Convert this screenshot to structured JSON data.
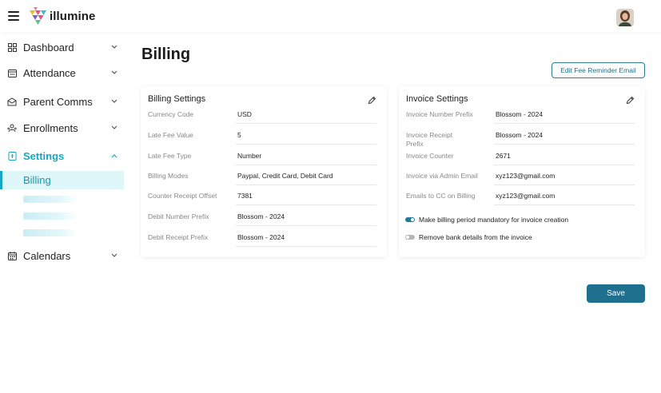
{
  "app": {
    "brand_name": "illumine",
    "brand_colors": [
      "#f2b233",
      "#e94f7c",
      "#3fb6e0",
      "#7b61c9",
      "#5cc28d"
    ],
    "accent": "#1aa6c0"
  },
  "sidebar": {
    "items": [
      {
        "label": "Dashboard",
        "icon": "dashboard-icon",
        "expanded": false
      },
      {
        "label": "Attendance",
        "icon": "attendance-icon",
        "expanded": false
      },
      {
        "label": "Parent Comms",
        "icon": "parent-comms-icon",
        "expanded": false
      },
      {
        "label": "Enrollments",
        "icon": "enrollments-icon",
        "expanded": false
      },
      {
        "label": "Settings",
        "icon": "settings-icon",
        "expanded": true,
        "active": true
      },
      {
        "label": "Calendars",
        "icon": "calendar-icon",
        "expanded": false
      }
    ],
    "settings_sub": {
      "active_label": "Billing"
    }
  },
  "main": {
    "title": "Billing",
    "edit_reminder_label": "Edit Fee Reminder Email",
    "save_label": "Save"
  },
  "billing_settings": {
    "title": "Billing Settings",
    "rows": [
      {
        "label": "Currency Code",
        "value": "USD"
      },
      {
        "label": "Late Fee Value",
        "value": "5"
      },
      {
        "label": "Late Fee Type",
        "value": "Number"
      },
      {
        "label": "Billing Modes",
        "value": "Paypal, Credit Card, Debit Card"
      },
      {
        "label": "Counter Receipt Offset",
        "value": "7381"
      },
      {
        "label": "Debit Number Prefix",
        "value": "Blossom - 2024"
      },
      {
        "label": "Debit Receipt Prefix",
        "value": "Blossom - 2024"
      }
    ]
  },
  "invoice_settings": {
    "title": "Invoice Settings",
    "rows": [
      {
        "label": "Invoice Number Prefix",
        "value": "Blossom - 2024"
      },
      {
        "label": "Invoice Receipt",
        "label2": "Prefix",
        "value": "Blossom - 2024"
      },
      {
        "label": "Invoice Counter",
        "value": "2671"
      },
      {
        "label": "Invoice via Admin Email",
        "value": "xyz123@gmail.com"
      },
      {
        "label": "Emails to CC on Billing",
        "value": "xyz123@gmail.com"
      }
    ],
    "toggles": [
      {
        "label": "Make billing period mandatory for invoice creation",
        "on": true
      },
      {
        "label": "Remove bank details from the invoice",
        "on": false
      }
    ]
  }
}
